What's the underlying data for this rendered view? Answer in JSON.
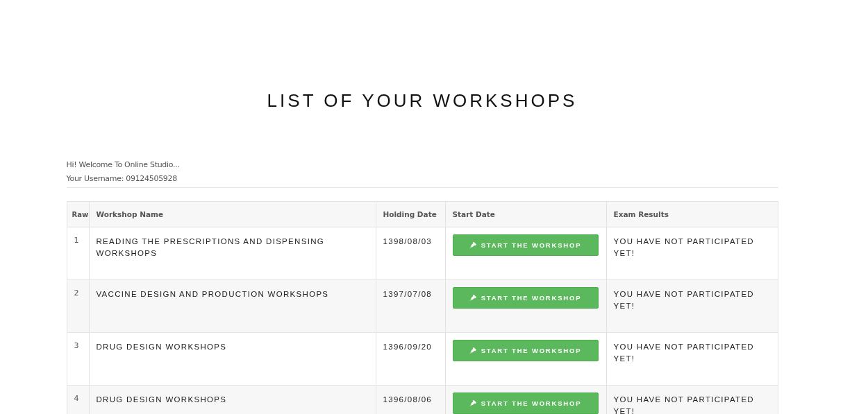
{
  "title": "LIST OF YOUR WORKSHOPS",
  "welcome": "Hi! Welcome To Online Studio...",
  "username": "Your Username: 09124505928",
  "table": {
    "columns": [
      "Raw",
      "Workshop Name",
      "Holding Date",
      "Start Date",
      "Exam Results"
    ],
    "rows": [
      {
        "raw": "1",
        "name": "READING THE PRESCRIPTIONS AND DISPENSING WORKSHOPS",
        "holding_date": "1398/08/03",
        "button": "START THE WORKSHOP",
        "result": "YOU HAVE NOT PARTICIPATED YET!"
      },
      {
        "raw": "2",
        "name": "VACCINE DESIGN AND PRODUCTION WORKSHOPS",
        "holding_date": "1397/07/08",
        "button": "START THE WORKSHOP",
        "result": "YOU HAVE NOT PARTICIPATED YET!"
      },
      {
        "raw": "3",
        "name": "DRUG DESIGN WORKSHOPS",
        "holding_date": "1396/09/20",
        "button": "START THE WORKSHOP",
        "result": "YOU HAVE NOT PARTICIPATED YET!"
      },
      {
        "raw": "4",
        "name": "DRUG DESIGN WORKSHOPS",
        "holding_date": "1396/08/06",
        "button": "START THE WORKSHOP",
        "result": "YOU HAVE NOT PARTICIPATED YET!"
      }
    ]
  }
}
